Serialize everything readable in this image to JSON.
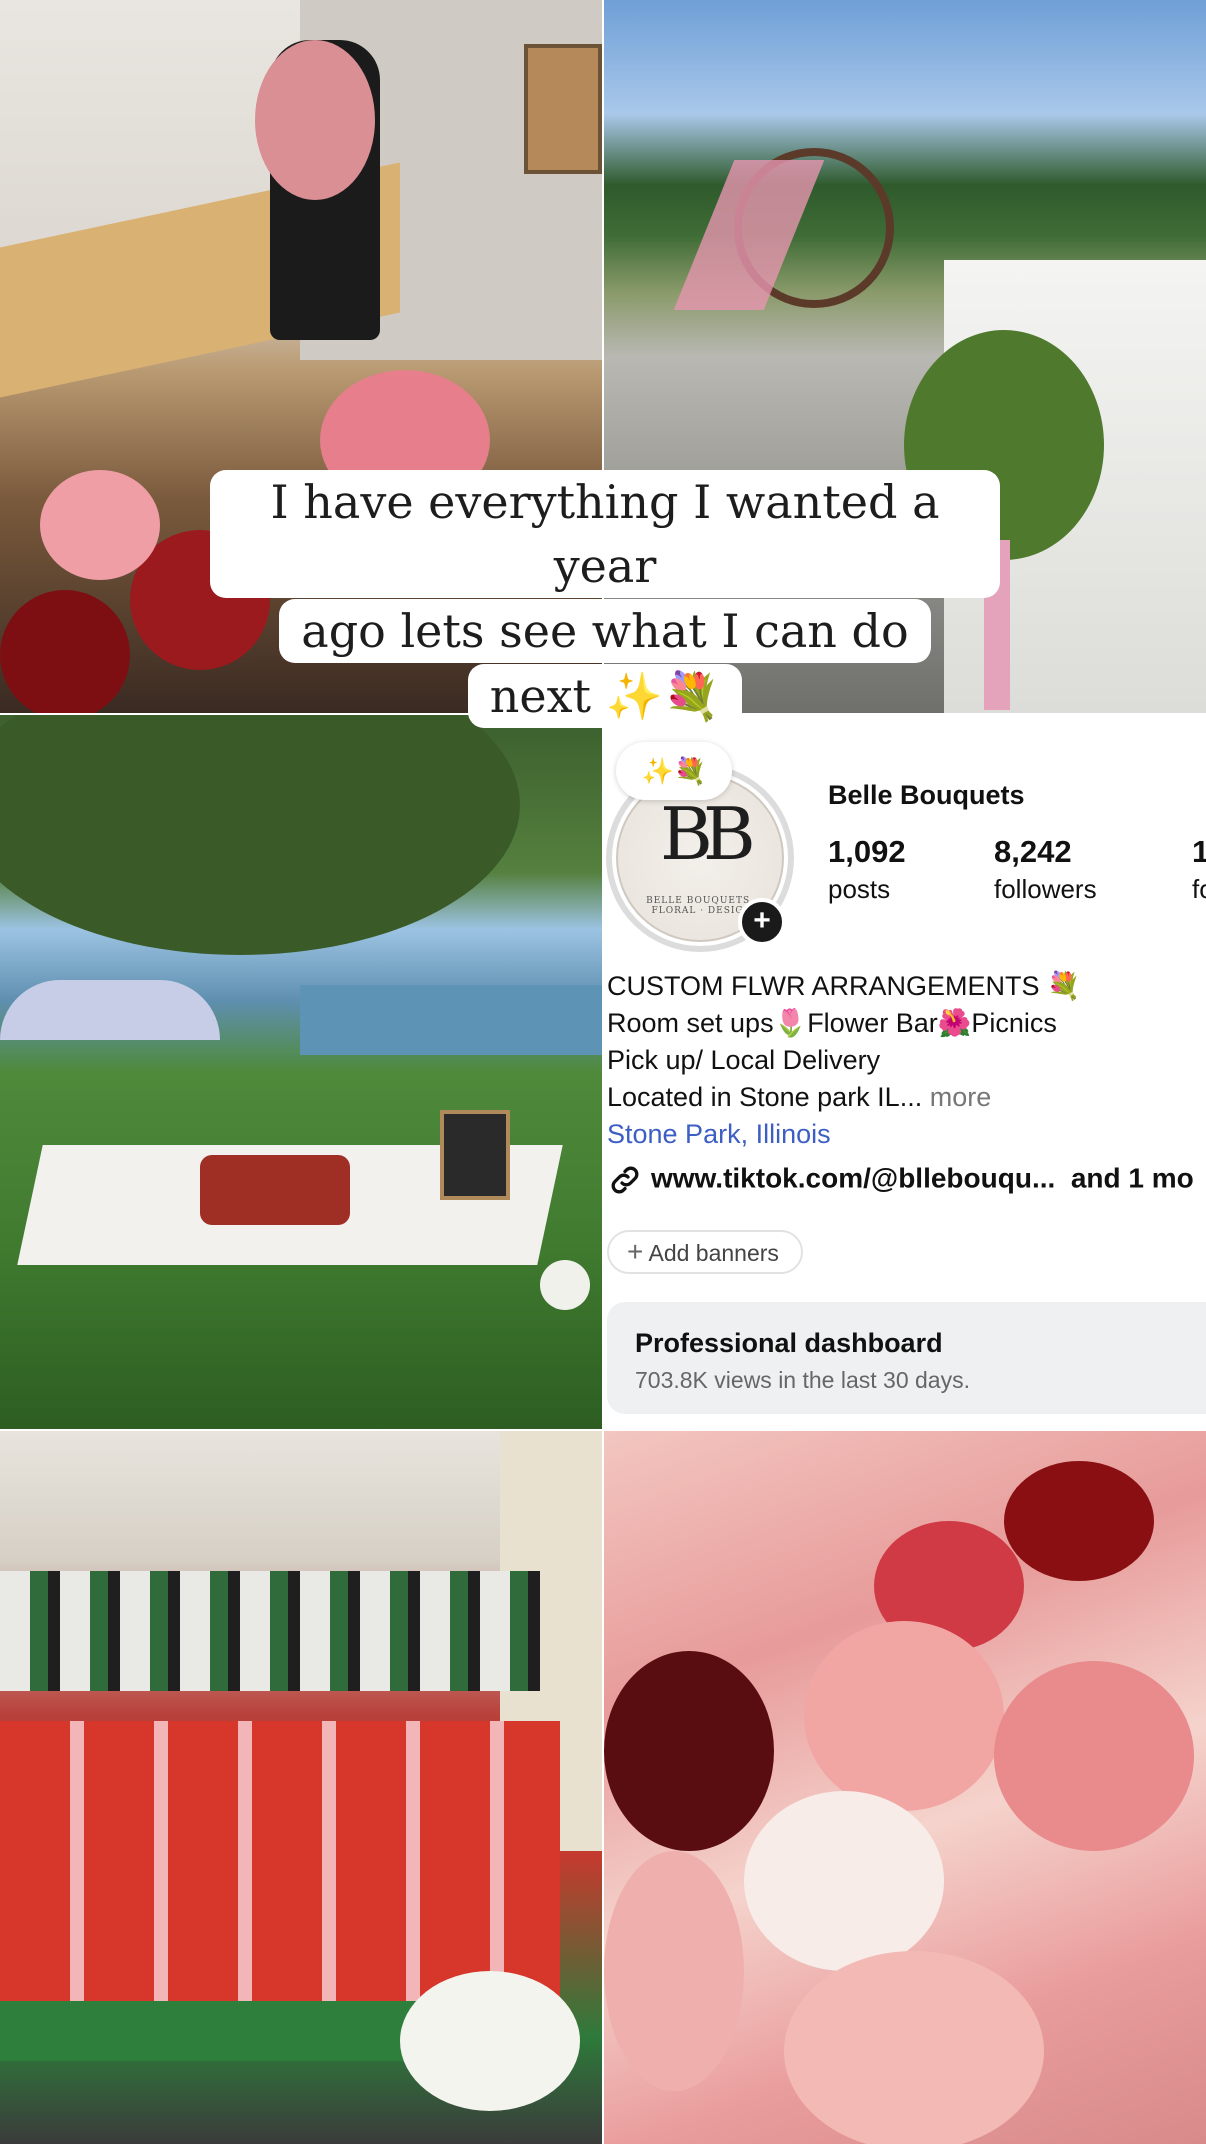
{
  "caption": {
    "line1": "I have everything I wanted a year",
    "line2": "ago lets see what I can do",
    "line3": "next ✨💐"
  },
  "profile": {
    "note": "✨💐",
    "avatar_monogram": "BB",
    "avatar_subtitle": "BELLE BOUQUETS · FLORAL · DESIGN",
    "name": "Belle Bouquets",
    "stats": [
      {
        "value": "1,092",
        "label": "posts"
      },
      {
        "value": "8,242",
        "label": "followers"
      },
      {
        "value": "1",
        "label": "fo"
      }
    ],
    "bio": [
      "CUSTOM FLWR ARRANGEMENTS 💐",
      "Room set ups🌷Flower Bar🌺Picnics",
      "Pick up/ Local Delivery",
      "Located in Stone park IL..."
    ],
    "bio_more": " more",
    "location": "Stone Park, Illinois",
    "link": "www.tiktok.com/@bllebouqu...",
    "link_more": "and 1 mo",
    "add_banners": "Add banners",
    "dashboard_title": "Professional dashboard",
    "dashboard_sub": "703.8K views in the last 30 days."
  },
  "photos": [
    {
      "icon": "bouquet-room-photo"
    },
    {
      "icon": "wedding-arch-photo"
    },
    {
      "icon": "picnic-setup-photo"
    },
    {
      "icon": "flower-buckets-photo"
    },
    {
      "icon": "bouquets-table-photo"
    }
  ]
}
